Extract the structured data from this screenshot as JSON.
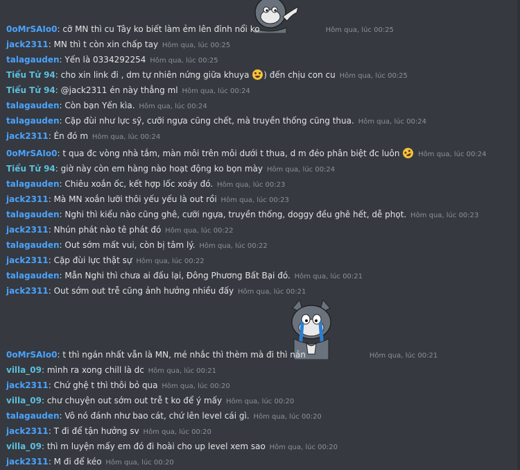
{
  "colors": {
    "background": "#36393f",
    "username_blue": "#4aa3ff",
    "username_cyan": "#5bc0de",
    "timestamp": "#8e9297",
    "text": "#e3e4e6"
  },
  "messages": [
    {
      "user": "0oMrSAIo0",
      "text": "cỡ MN thì cu Tây ko biết làm ẻm lên đỉnh nổi ko",
      "ts": "Hôm qua, lúc 00:25",
      "color": "#4aa3ff"
    },
    {
      "user": "jack2311",
      "text": "MN thì t còn xin chấp tay",
      "ts": "Hôm qua, lúc 00:25",
      "color": "#4aa3ff"
    },
    {
      "user": "talagauden",
      "text": "Yến là 0334292254",
      "ts": "Hôm qua, lúc 00:25",
      "color": "#4aa3ff"
    },
    {
      "user": "Tiểu Tử 94",
      "text": "cho xin link đi , dm tự nhiên nứng giữa khuya",
      "after": "đến chịu con cu",
      "ts": "Hôm qua, lúc 00:25",
      "color": "#5bc0de"
    },
    {
      "user": "Tiểu Tử 94",
      "text": "@jack2311 én này thẳng ml",
      "ts": "Hôm qua, lúc 00:24",
      "color": "#5bc0de"
    },
    {
      "user": "talagauden",
      "text": "Còn bạn Yến kìa.",
      "ts": "Hôm qua, lúc 00:24",
      "color": "#4aa3ff"
    },
    {
      "user": "talagauden",
      "text": "Cặp đùi như lực sỹ, cưỡi ngựa cũng chết, mà truyền thống cũng thua.",
      "ts": "Hôm qua, lúc 00:24",
      "color": "#4aa3ff"
    },
    {
      "user": "jack2311",
      "text": "Én đó m",
      "ts": "Hôm qua, lúc 00:24",
      "color": "#4aa3ff"
    },
    {
      "user": "0oMrSAIo0",
      "text": "t qua đc vòng nhà tắm, màn môi trên môi dưới t thua, d m đéo phân biệt đc luôn",
      "ts": "Hôm qua, lúc 00:24",
      "color": "#4aa3ff"
    },
    {
      "user": "Tiểu Tử 94",
      "text": "giờ này còn em hàng nào hoạt động ko bọn mày",
      "ts": "Hôm qua, lúc 00:24",
      "color": "#5bc0de"
    },
    {
      "user": "talagauden",
      "text": "Chiêu xoắn ốc, kết hợp lốc xoáy đó.",
      "ts": "Hôm qua, lúc 00:23",
      "color": "#4aa3ff"
    },
    {
      "user": "jack2311",
      "text": "Mà MN xoắn lưỡi thôi yếu yếu là out rồi",
      "ts": "Hôm qua, lúc 00:23",
      "color": "#4aa3ff"
    },
    {
      "user": "talagauden",
      "text": "Nghi thì kiểu nào cũng ghê, cưỡi ngựa, truyền thống, doggy đều ghê hết, dễ phọt.",
      "ts": "Hôm qua, lúc 00:23",
      "color": "#4aa3ff"
    },
    {
      "user": "jack2311",
      "text": "Nhún phát nào tê phát đó",
      "ts": "Hôm qua, lúc 00:22",
      "color": "#4aa3ff"
    },
    {
      "user": "talagauden",
      "text": "Out sớm mất vui, còn bị tâm lý.",
      "ts": "Hôm qua, lúc 00:22",
      "color": "#4aa3ff"
    },
    {
      "user": "jack2311",
      "text": "Cặp đùi lực thật sự",
      "ts": "Hôm qua, lúc 00:22",
      "color": "#4aa3ff"
    },
    {
      "user": "talagauden",
      "text": "Mẫn Nghi thì chưa ai đấu lại, Đông Phương Bất Bại đó.",
      "ts": "Hôm qua, lúc 00:21",
      "color": "#4aa3ff"
    },
    {
      "user": "jack2311",
      "text": "Out sớm out trễ cũng ảnh hưởng nhiều đấy",
      "ts": "Hôm qua, lúc 00:21",
      "color": "#4aa3ff"
    },
    {
      "user": "0oMrSAIo0",
      "text": "t thì ngán nhất vẫn là MN, mé nhắc thì thèm mà đi thì nản",
      "ts": "Hôm qua, lúc 00:21",
      "color": "#4aa3ff"
    },
    {
      "user": "villa_09",
      "text": "mình ra xong chill là dc",
      "ts": "Hôm qua, lúc 00:21",
      "color": "#5bc0de"
    },
    {
      "user": "jack2311",
      "text": "Chứ ghệ t thì thôi bỏ qua",
      "ts": "Hôm qua, lúc 00:20",
      "color": "#4aa3ff"
    },
    {
      "user": "villa_09",
      "text": "chư chuyện out sớm out trễ t ko để ý mấy",
      "ts": "Hôm qua, lúc 00:20",
      "color": "#5bc0de"
    },
    {
      "user": "talagauden",
      "text": "Vô nó đánh như bao cát, chứ lên level cái gì.",
      "ts": "Hôm qua, lúc 00:20",
      "color": "#4aa3ff"
    },
    {
      "user": "jack2311",
      "text": "T đi để tận hưởng sv",
      "ts": "Hôm qua, lúc 00:20",
      "color": "#4aa3ff"
    },
    {
      "user": "villa_09",
      "text": "thì m luyện mấy em đó đi hoài cho up level xem sao",
      "ts": "Hôm qua, lúc 00:20",
      "color": "#5bc0de"
    },
    {
      "user": "jack2311",
      "text": "M đi để kéo",
      "ts": "Hôm qua, lúc 00:20",
      "color": "#4aa3ff"
    }
  ]
}
